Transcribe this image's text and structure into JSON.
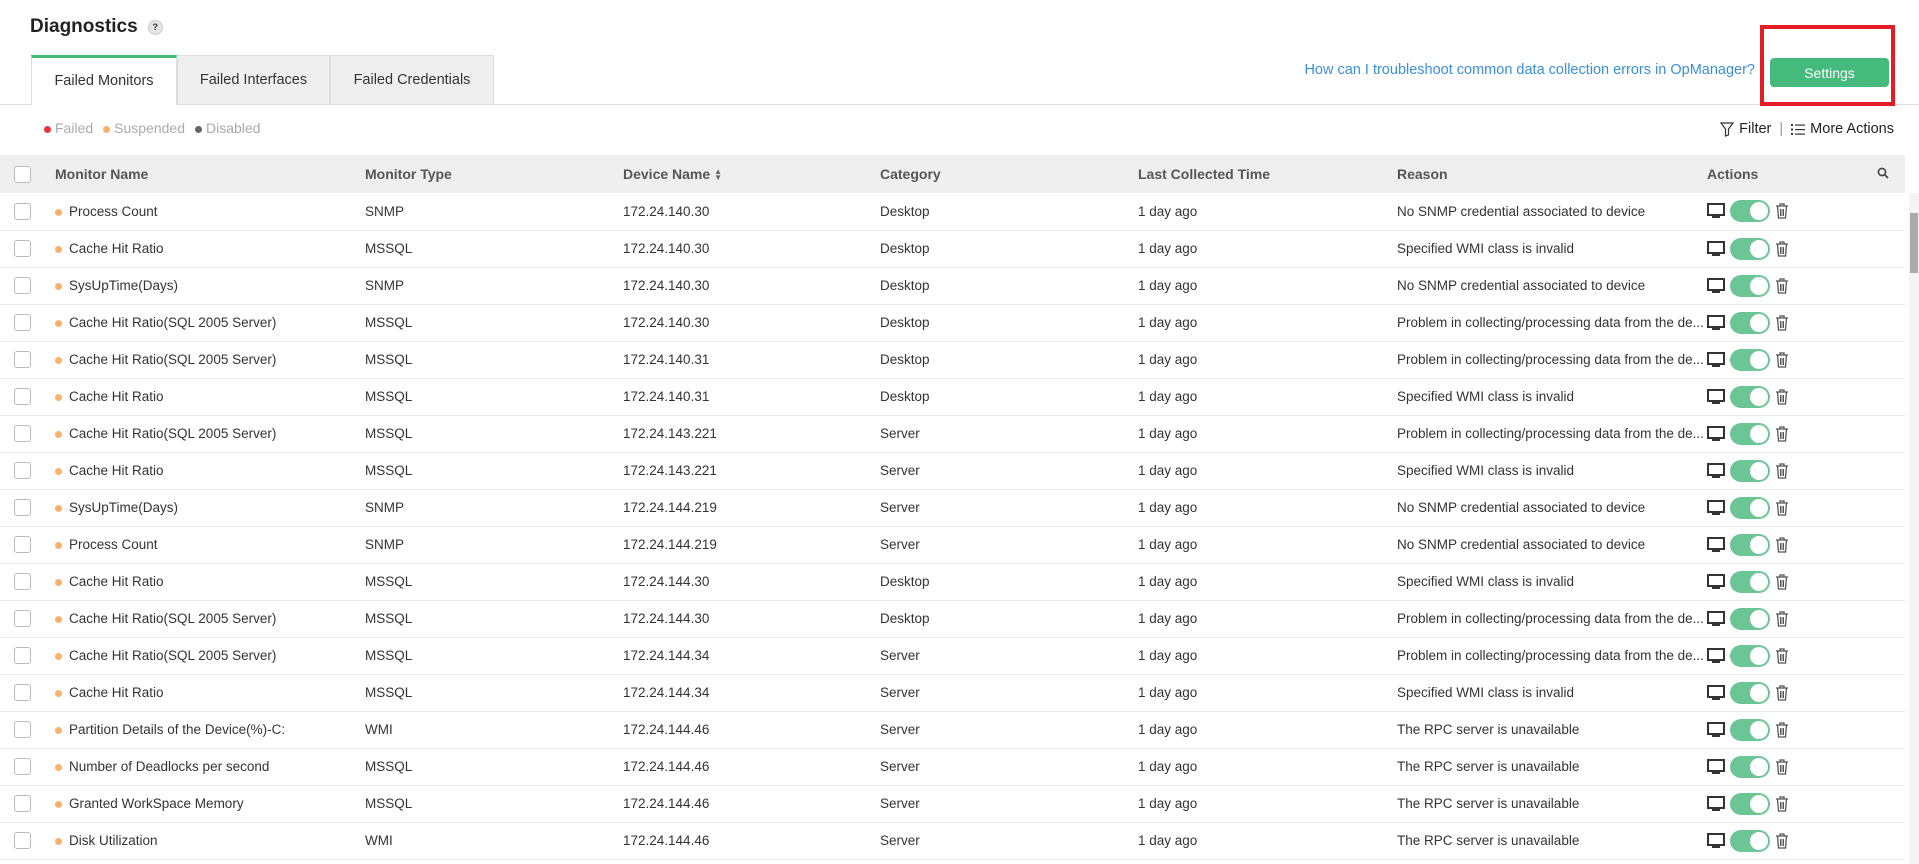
{
  "page": {
    "title": "Diagnostics",
    "help": "?"
  },
  "tabs": [
    {
      "label": "Failed Monitors",
      "active": true
    },
    {
      "label": "Failed Interfaces"
    },
    {
      "label": "Failed Credentials"
    }
  ],
  "help_link": "How can I troubleshoot common data collection errors in OpManager?",
  "settings_label": "Settings",
  "legend": [
    {
      "label": "Failed",
      "color": "#e8353b"
    },
    {
      "label": "Suspended",
      "color": "#f8b26a"
    },
    {
      "label": "Disabled",
      "color": "#666666"
    }
  ],
  "toolbar": {
    "filter": "Filter",
    "separator": "|",
    "more_actions": "More Actions"
  },
  "columns": [
    "Monitor Name",
    "Monitor Type",
    "Device Name",
    "Category",
    "Last Collected Time",
    "Reason",
    "Actions"
  ],
  "sort": {
    "column": "Device Name",
    "indicator": "▴▾"
  },
  "colors": {
    "accent": "#44bb7c",
    "toggle_on": "#6cc595",
    "suspended": "#f8b26a",
    "link": "#3b8fd9",
    "highlight": "#e51c23"
  },
  "rows": [
    {
      "name": "Process Count",
      "type": "SNMP",
      "device": "172.24.140.30",
      "category": "Desktop",
      "time": "1 day ago",
      "reason": "No SNMP credential associated to device"
    },
    {
      "name": "Cache Hit Ratio",
      "type": "MSSQL",
      "device": "172.24.140.30",
      "category": "Desktop",
      "time": "1 day ago",
      "reason": "Specified WMI class is invalid"
    },
    {
      "name": "SysUpTime(Days)",
      "type": "SNMP",
      "device": "172.24.140.30",
      "category": "Desktop",
      "time": "1 day ago",
      "reason": "No SNMP credential associated to device"
    },
    {
      "name": "Cache Hit Ratio(SQL 2005 Server)",
      "type": "MSSQL",
      "device": "172.24.140.30",
      "category": "Desktop",
      "time": "1 day ago",
      "reason": "Problem in collecting/processing data from the de..."
    },
    {
      "name": "Cache Hit Ratio(SQL 2005 Server)",
      "type": "MSSQL",
      "device": "172.24.140.31",
      "category": "Desktop",
      "time": "1 day ago",
      "reason": "Problem in collecting/processing data from the de..."
    },
    {
      "name": "Cache Hit Ratio",
      "type": "MSSQL",
      "device": "172.24.140.31",
      "category": "Desktop",
      "time": "1 day ago",
      "reason": "Specified WMI class is invalid"
    },
    {
      "name": "Cache Hit Ratio(SQL 2005 Server)",
      "type": "MSSQL",
      "device": "172.24.143.221",
      "category": "Server",
      "time": "1 day ago",
      "reason": "Problem in collecting/processing data from the de..."
    },
    {
      "name": "Cache Hit Ratio",
      "type": "MSSQL",
      "device": "172.24.143.221",
      "category": "Server",
      "time": "1 day ago",
      "reason": "Specified WMI class is invalid"
    },
    {
      "name": "SysUpTime(Days)",
      "type": "SNMP",
      "device": "172.24.144.219",
      "category": "Server",
      "time": "1 day ago",
      "reason": "No SNMP credential associated to device"
    },
    {
      "name": "Process Count",
      "type": "SNMP",
      "device": "172.24.144.219",
      "category": "Server",
      "time": "1 day ago",
      "reason": "No SNMP credential associated to device"
    },
    {
      "name": "Cache Hit Ratio",
      "type": "MSSQL",
      "device": "172.24.144.30",
      "category": "Desktop",
      "time": "1 day ago",
      "reason": "Specified WMI class is invalid"
    },
    {
      "name": "Cache Hit Ratio(SQL 2005 Server)",
      "type": "MSSQL",
      "device": "172.24.144.30",
      "category": "Desktop",
      "time": "1 day ago",
      "reason": "Problem in collecting/processing data from the de..."
    },
    {
      "name": "Cache Hit Ratio(SQL 2005 Server)",
      "type": "MSSQL",
      "device": "172.24.144.34",
      "category": "Server",
      "time": "1 day ago",
      "reason": "Problem in collecting/processing data from the de..."
    },
    {
      "name": "Cache Hit Ratio",
      "type": "MSSQL",
      "device": "172.24.144.34",
      "category": "Server",
      "time": "1 day ago",
      "reason": "Specified WMI class is invalid"
    },
    {
      "name": "Partition Details of the Device(%)-C:",
      "type": "WMI",
      "device": "172.24.144.46",
      "category": "Server",
      "time": "1 day ago",
      "reason": "The RPC server is unavailable"
    },
    {
      "name": "Number of Deadlocks per second",
      "type": "MSSQL",
      "device": "172.24.144.46",
      "category": "Server",
      "time": "1 day ago",
      "reason": "The RPC server is unavailable"
    },
    {
      "name": "Granted WorkSpace Memory",
      "type": "MSSQL",
      "device": "172.24.144.46",
      "category": "Server",
      "time": "1 day ago",
      "reason": "The RPC server is unavailable"
    },
    {
      "name": "Disk Utilization",
      "type": "WMI",
      "device": "172.24.144.46",
      "category": "Server",
      "time": "1 day ago",
      "reason": "The RPC server is unavailable"
    }
  ]
}
